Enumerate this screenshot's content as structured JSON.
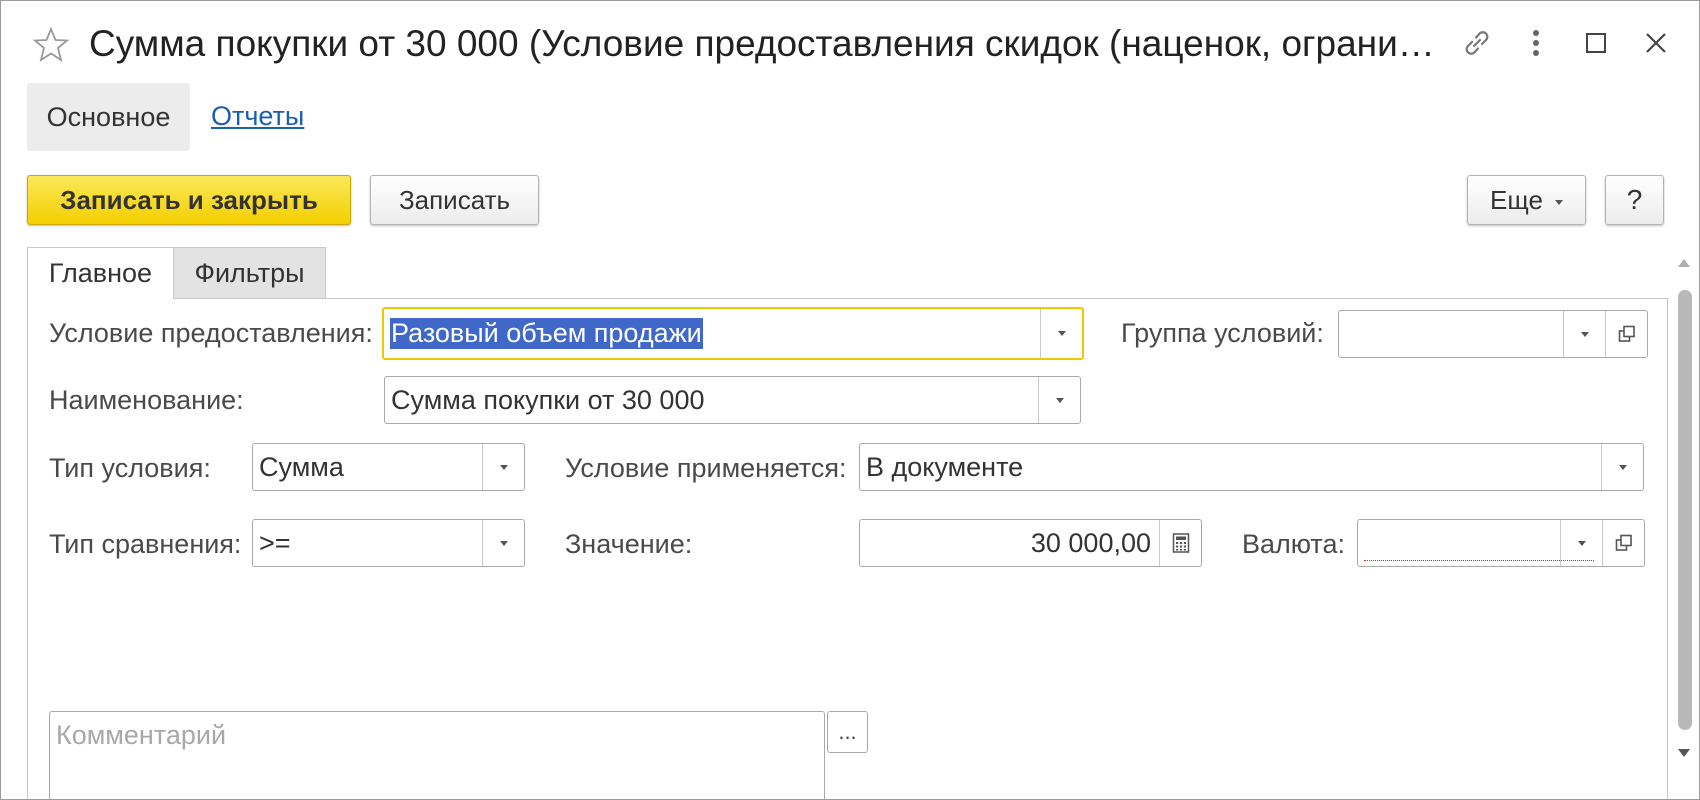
{
  "window": {
    "title": "Сумма покупки от 30 000 (Условие предоставления скидок (наценок, ограни…",
    "icons": [
      "star-icon",
      "link-icon",
      "more-vertical-icon",
      "maximize-icon",
      "close-icon"
    ]
  },
  "nav": {
    "main_label": "Основное",
    "reports_label": "Отчеты"
  },
  "toolbar": {
    "save_close_label": "Записать и закрыть",
    "save_label": "Записать",
    "more_label": "Еще",
    "help_label": "?"
  },
  "tabs": [
    {
      "label": "Главное",
      "active": true
    },
    {
      "label": "Фильтры",
      "active": false
    }
  ],
  "form": {
    "condition": {
      "label": "Условие предоставления:",
      "value": "Разовый объем продажи"
    },
    "group": {
      "label": "Группа условий:",
      "value": ""
    },
    "name": {
      "label": "Наименование:",
      "value": "Сумма покупки от 30 000"
    },
    "condition_type": {
      "label": "Тип условия:",
      "value": "Сумма"
    },
    "applies": {
      "label": "Условие применяется:",
      "value": "В документе"
    },
    "comparison": {
      "label": "Тип сравнения:",
      "value": ">="
    },
    "value": {
      "label": "Значение:",
      "value": "30 000,00"
    },
    "currency": {
      "label": "Валюта:",
      "value": ""
    },
    "comment": {
      "placeholder": "Комментарий",
      "button_label": "..."
    }
  },
  "colors": {
    "primary_button": "#f3cf00",
    "focus_border": "#f0c800",
    "selection": "#3f68c9",
    "link": "#1a5fb4",
    "required_underline": "#e02020"
  }
}
